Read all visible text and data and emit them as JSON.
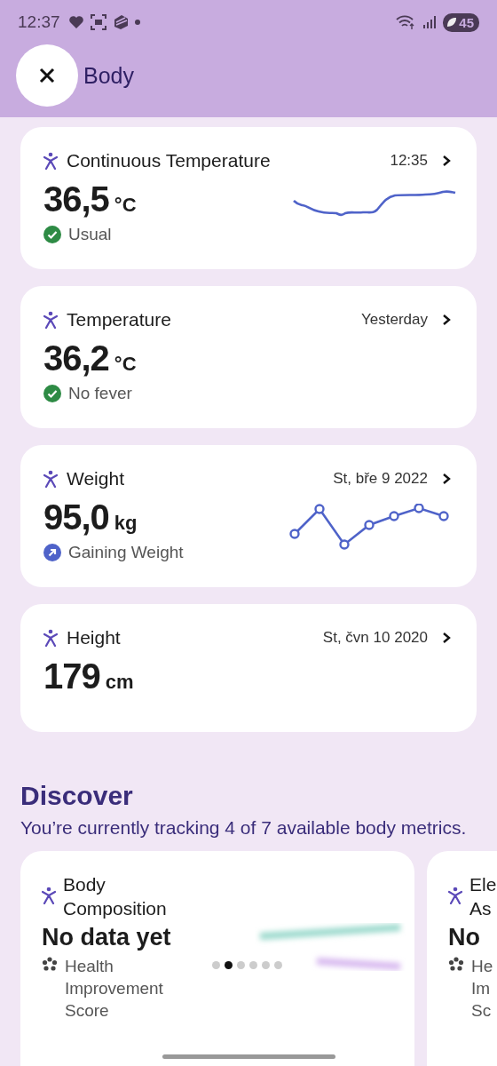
{
  "status_bar": {
    "time": "12:37",
    "battery": "45"
  },
  "header": {
    "title": "Body"
  },
  "metrics": [
    {
      "title": "Continuous Temperature",
      "date": "12:35",
      "value": "36,5",
      "unit": "°C",
      "status": {
        "kind": "check",
        "text": "Usual"
      },
      "sparkline": {
        "kind": "line"
      }
    },
    {
      "title": "Temperature",
      "date": "Yesterday",
      "value": "36,2",
      "unit": "°C",
      "status": {
        "kind": "check",
        "text": "No fever"
      }
    },
    {
      "title": "Weight",
      "date": "St, bře 9 2022",
      "value": "95,0",
      "unit": "kg",
      "status": {
        "kind": "trend",
        "text": "Gaining Weight"
      },
      "sparkline": {
        "kind": "dots"
      }
    },
    {
      "title": "Height",
      "date": "St, čvn 10 2020",
      "value": "179",
      "unit": "cm"
    }
  ],
  "discover": {
    "title": "Discover",
    "subtitle": "You’re currently tracking 4 of 7 available body metrics.",
    "cards": [
      {
        "title_lines": [
          "Body",
          "Composition"
        ],
        "value": "No data yet",
        "footer_lines": [
          "Health",
          "Improvement",
          "Score"
        ],
        "preview": {
          "kind": "picture"
        }
      },
      {
        "title_lines": [
          "Ele",
          "As"
        ],
        "value": "No",
        "footer_lines": [
          "He",
          "Im",
          "Sc"
        ]
      }
    ],
    "pager": [
      {
        "selected": false
      },
      {
        "selected": true
      },
      {
        "selected": false
      },
      {
        "selected": false
      },
      {
        "selected": false
      },
      {
        "selected": false
      }
    ]
  }
}
